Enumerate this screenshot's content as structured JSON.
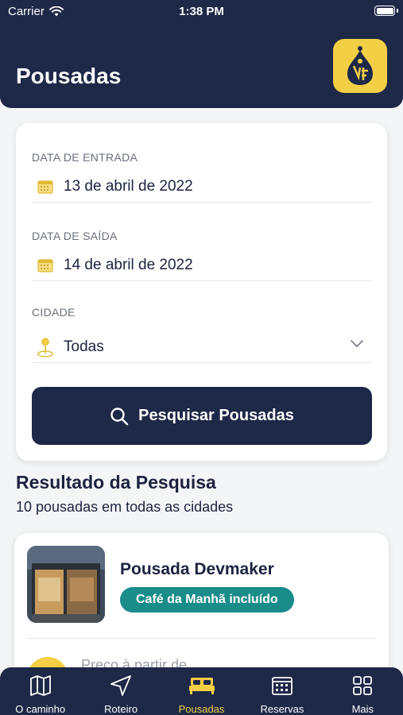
{
  "status_bar": {
    "carrier": "Carrier",
    "time": "1:38 PM"
  },
  "header": {
    "title": "Pousadas"
  },
  "search_form": {
    "checkin": {
      "label": "DATA DE ENTRADA",
      "value": "13 de abril de 2022"
    },
    "checkout": {
      "label": "DATA DE SAÍDA",
      "value": "14 de abril de 2022"
    },
    "city": {
      "label": "CIDADE",
      "value": "Todas"
    },
    "search_button": "Pesquisar Pousadas"
  },
  "results": {
    "title": "Resultado da Pesquisa",
    "subtitle": "10 pousadas em todas as cidades",
    "items": [
      {
        "name": "Pousada Devmaker",
        "badge": "Café da Manhã incluído",
        "price_label": "Preço à partir de"
      }
    ]
  },
  "tab_bar": {
    "tabs": [
      {
        "label": "O caminho",
        "icon": "map-icon"
      },
      {
        "label": "Roteiro",
        "icon": "navigation-icon"
      },
      {
        "label": "Pousadas",
        "icon": "bed-icon",
        "active": true
      },
      {
        "label": "Reservas",
        "icon": "calendar-icon"
      },
      {
        "label": "Mais",
        "icon": "grid-icon"
      }
    ]
  },
  "colors": {
    "navy": "#1e2847",
    "accent": "#f3cf45",
    "teal": "#1a8c8a"
  }
}
